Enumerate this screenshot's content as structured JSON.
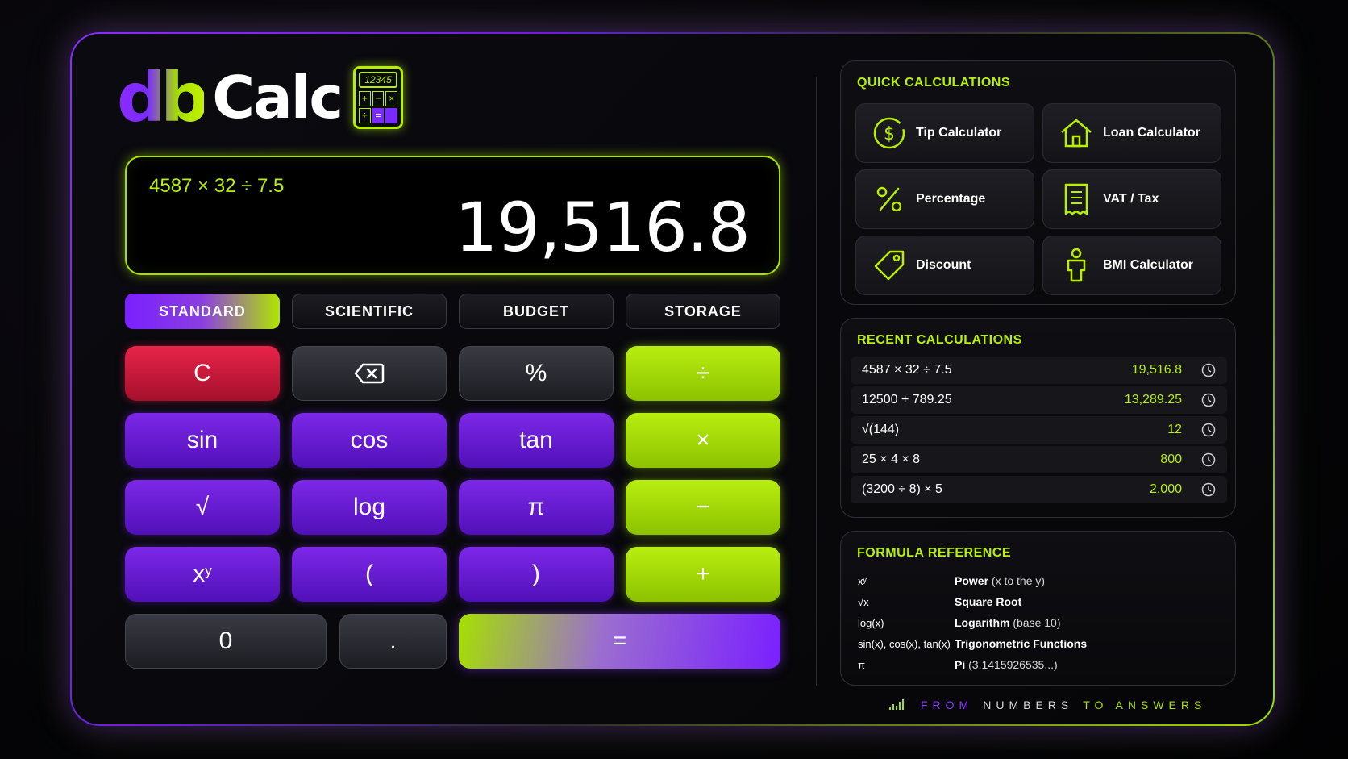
{
  "logo": {
    "db": "db",
    "calc": "Calc",
    "icon_screen": "12345",
    "icon_keys": [
      "+",
      "−",
      "×",
      "÷",
      "="
    ]
  },
  "display": {
    "expression": "4587 × 32 ÷ 7.5",
    "result": "19,516.8"
  },
  "tabs": [
    {
      "label": "STANDARD",
      "active": true
    },
    {
      "label": "SCIENTIFIC",
      "active": false
    },
    {
      "label": "BUDGET",
      "active": false
    },
    {
      "label": "STORAGE",
      "active": false
    }
  ],
  "keys": {
    "clear": "C",
    "backspace_icon": "backspace-icon",
    "percent": "%",
    "divide": "÷",
    "sin": "sin",
    "cos": "cos",
    "tan": "tan",
    "multiply": "×",
    "sqrt": "√",
    "log": "log",
    "pi": "π",
    "minus": "−",
    "power_base": "x",
    "power_exp": "y",
    "open_paren": "(",
    "close_paren": ")",
    "plus": "+",
    "zero": "0",
    "dot": ".",
    "equals": "="
  },
  "quick": {
    "title": "QUICK CALCULATIONS",
    "items": [
      {
        "label": "Tip Calculator",
        "icon": "dollar-icon"
      },
      {
        "label": "Loan Calculator",
        "icon": "house-icon"
      },
      {
        "label": "Percentage",
        "icon": "percent-icon"
      },
      {
        "label": "VAT / Tax",
        "icon": "receipt-icon"
      },
      {
        "label": "Discount",
        "icon": "tag-icon"
      },
      {
        "label": "BMI Calculator",
        "icon": "person-icon"
      }
    ]
  },
  "recent": {
    "title": "RECENT CALCULATIONS",
    "rows": [
      {
        "expr": "4587 × 32 ÷ 7.5",
        "value": "19,516.8"
      },
      {
        "expr": "12500 + 789.25",
        "value": "13,289.25"
      },
      {
        "expr": "√(144)",
        "value": "12"
      },
      {
        "expr": "25 × 4 × 8",
        "value": "800"
      },
      {
        "expr": "(3200 ÷ 8) × 5",
        "value": "2,000"
      }
    ]
  },
  "formula": {
    "title": "FORMULA REFERENCE",
    "rows": [
      {
        "sym": "xʸ",
        "name": "Power",
        "extra": " (x to the y)"
      },
      {
        "sym": "√x",
        "name": "Square Root",
        "extra": ""
      },
      {
        "sym": "log(x)",
        "name": "Logarithm",
        "extra": " (base 10)"
      },
      {
        "sym": "sin(x), cos(x), tan(x)",
        "name": "Trigonometric Functions",
        "extra": ""
      },
      {
        "sym": "π",
        "name": "Pi",
        "extra": " (3.1415926535...)"
      }
    ]
  },
  "tagline": {
    "w1": "FROM",
    "w2": "NUMBERS",
    "w3": "TO ANSWERS"
  },
  "colors": {
    "accent_green": "#b8f000",
    "accent_purple": "#7a20ff",
    "clear_red": "#e8244a"
  }
}
